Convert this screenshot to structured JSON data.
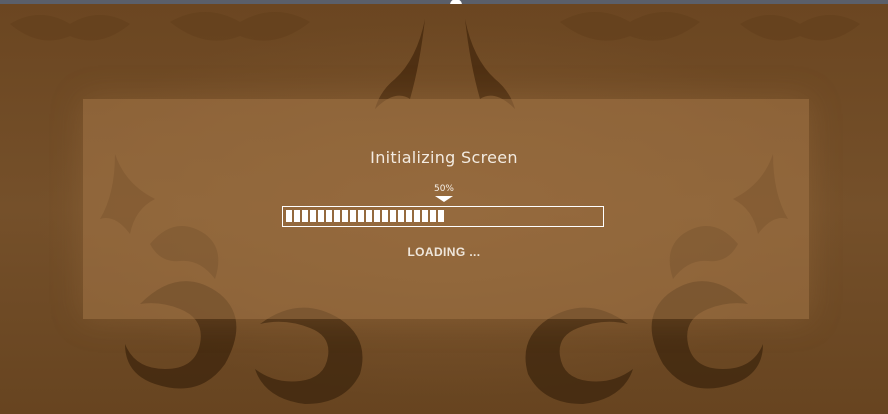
{
  "screen": {
    "title": "Initializing Screen",
    "status_text": "LOADING ...",
    "progress": {
      "label": "50%",
      "fraction": 0.5
    }
  },
  "colors": {
    "background": "#6e4a24",
    "panel": "#a57848",
    "text": "#f3ebe1",
    "bar": "#ffffff"
  },
  "icons": {
    "progress_pointer": "triangle-down-icon",
    "background_art": "naga-dragon-pattern-icon"
  }
}
